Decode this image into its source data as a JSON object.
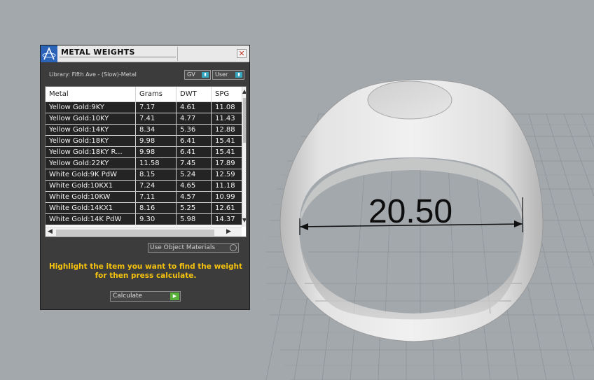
{
  "panel": {
    "title": "METAL WEIGHTS",
    "close_glyph": "✕",
    "library_label": "Library: Fifth Ave - (Slow)-Metal",
    "toggles": {
      "gv": "GV",
      "user": "User"
    },
    "columns": [
      "Metal",
      "Grams",
      "DWT",
      "SPG"
    ],
    "rows": [
      [
        "Yellow Gold:9KY",
        "7.17",
        "4.61",
        "11.08"
      ],
      [
        "Yellow Gold:10KY",
        "7.41",
        "4.77",
        "11.43"
      ],
      [
        "Yellow Gold:14KY",
        "8.34",
        "5.36",
        "12.88"
      ],
      [
        "Yellow Gold:18KY",
        "9.98",
        "6.41",
        "15.41"
      ],
      [
        "Yellow Gold:18KY R...",
        "9.98",
        "6.41",
        "15.41"
      ],
      [
        "Yellow Gold:22KY",
        "11.58",
        "7.45",
        "17.89"
      ],
      [
        "White Gold:9K PdW",
        "8.15",
        "5.24",
        "12.59"
      ],
      [
        "White Gold:10KX1",
        "7.24",
        "4.65",
        "11.18"
      ],
      [
        "White Gold:10KW",
        "7.11",
        "4.57",
        "10.99"
      ],
      [
        "White Gold:14KX1",
        "8.16",
        "5.25",
        "12.61"
      ],
      [
        "White Gold:14K PdW",
        "9.30",
        "5.98",
        "14.37"
      ]
    ],
    "use_object_materials": "Use Object Materials",
    "instruction_line1": "Highlight the item you want to find the weight",
    "instruction_line2": "for then press calculate.",
    "calculate_label": "Calculate"
  },
  "viewport": {
    "dimension_value": "20.50",
    "object": "ring-model"
  },
  "colors": {
    "viewport_background": "#a3a8ad",
    "grid_line": "#8e9398",
    "panel_background": "#3c3c3c",
    "row_background": "#242424",
    "instruction_text": "#f4c20d",
    "toggle_accent": "#35a7c1",
    "calculate_icon": "#58b23a"
  },
  "icons": {
    "app_logo": "app-logo-icon",
    "close": "close-icon",
    "toggle_knob": "toggle-knob-icon",
    "calculate": "play-arrow-icon",
    "scroll_up": "scroll-up-icon",
    "scroll_down": "scroll-down-icon"
  }
}
